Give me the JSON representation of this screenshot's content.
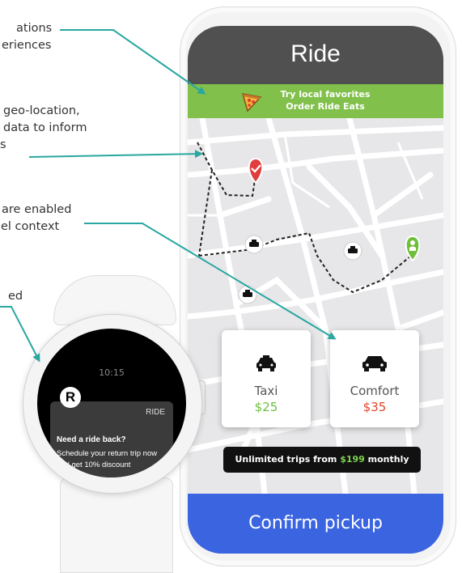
{
  "callouts": [
    {
      "lines": [
        "ations",
        "eriences"
      ]
    },
    {
      "lines": [
        "geo-location,",
        "data to inform",
        "s"
      ]
    },
    {
      "lines": [
        "are enabled",
        "el context"
      ]
    },
    {
      "lines": [
        "ed"
      ]
    }
  ],
  "phone": {
    "app_title": "Ride",
    "promo": {
      "line1": "Try local favorites",
      "line2": "Order Ride Eats",
      "icon": "pizza-icon"
    },
    "rides": [
      {
        "name": "Taxi",
        "price": "$25",
        "icon": "taxi-icon",
        "price_color": "#6cbf3f"
      },
      {
        "name": "Comfort",
        "price": "$35",
        "icon": "car-icon",
        "price_color": "#e0452b"
      }
    ],
    "subscription": {
      "prefix": "Unlimited trips from ",
      "price": "$199",
      "suffix": " monthly"
    },
    "confirm_label": "Confirm pickup"
  },
  "watch": {
    "time": "10:15",
    "logo": "R",
    "app_name": "RIDE",
    "heading": "Need a ride back?",
    "body": "Schedule your return trip now and get 10% discount"
  },
  "colors": {
    "header": "#505050",
    "promo": "#80c04b",
    "confirm": "#3a64e0",
    "accent_line": "#2aa7a0",
    "marker_red": "#e03e3e",
    "marker_green": "#6fbf3a"
  }
}
